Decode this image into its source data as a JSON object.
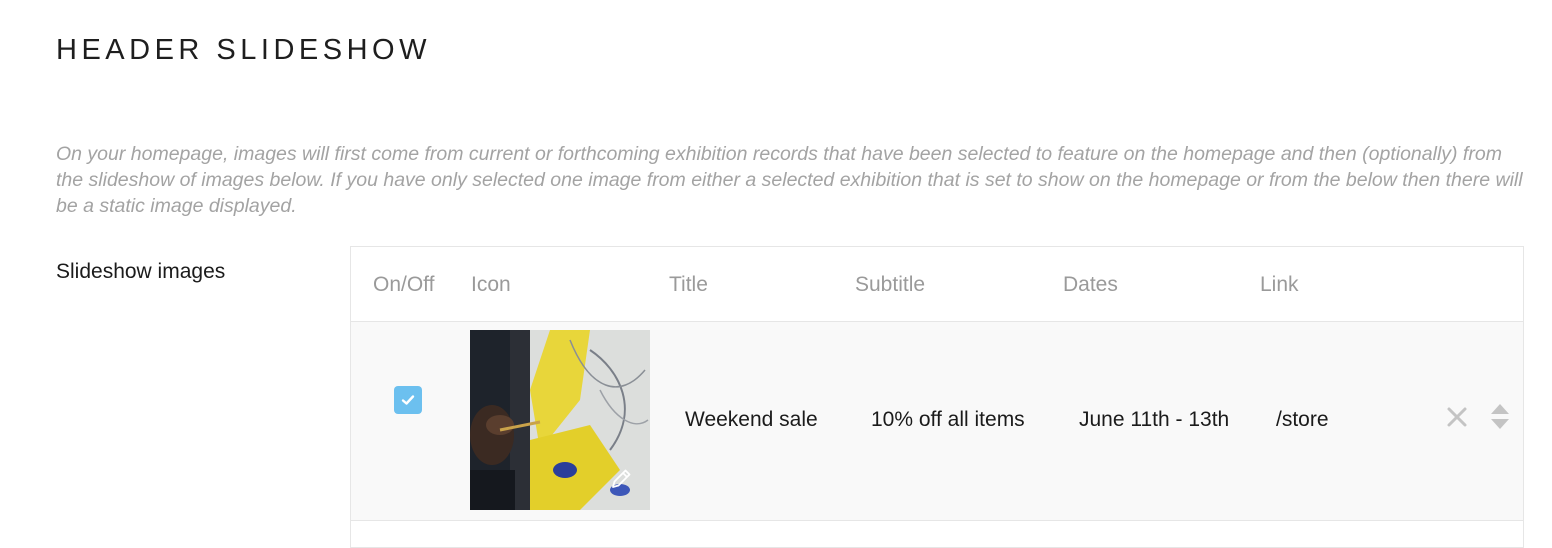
{
  "section": {
    "title": "HEADER SLIDESHOW",
    "description": "On your homepage, images will first come from current or forthcoming exhibition records that have been selected to feature on the homepage and then (optionally) from the slideshow of images below. If you have only selected one image from either a selected exhibition that is set to show on the homepage or from the below then there will be a static image displayed."
  },
  "field": {
    "label": "Slideshow images"
  },
  "table": {
    "columns": {
      "onoff": "On/Off",
      "icon": "Icon",
      "title": "Title",
      "subtitle": "Subtitle",
      "dates": "Dates",
      "link": "Link"
    },
    "rows": [
      {
        "enabled": true,
        "icon": "painting-thumbnail",
        "title": "Weekend sale",
        "subtitle": "10% off all items",
        "dates": "June 11th - 13th",
        "link": "/store"
      }
    ]
  },
  "icons": {
    "checkbox": "check-icon",
    "edit": "pencil-icon",
    "delete": "close-icon",
    "reorder": "sort-arrows-icon"
  },
  "colors": {
    "accent": "#6cc0ef",
    "muted_text": "#a3a3a3",
    "header_text": "#9a9a9a",
    "row_background": "#f9f9f9",
    "border": "#e6e6e6"
  }
}
